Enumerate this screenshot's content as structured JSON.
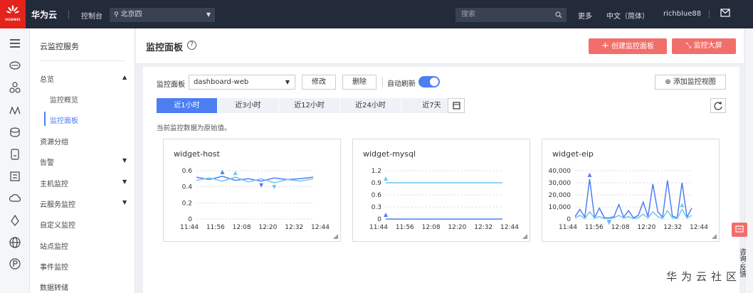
{
  "topbar": {
    "logo_text": "HUAWEI",
    "brand": "华为云",
    "console": "控制台",
    "region": "北京四",
    "search_placeholder": "搜索",
    "more": "更多",
    "language": "中文（简体）",
    "user": "richblue88"
  },
  "sidebar": {
    "title": "云监控服务",
    "items": [
      {
        "label": "总览",
        "caret": "▲"
      },
      {
        "label": "监控概览"
      },
      {
        "label": "监控面板"
      },
      {
        "label": "资源分组"
      },
      {
        "label": "告警",
        "caret": "▼"
      },
      {
        "label": "主机监控",
        "caret": "▼"
      },
      {
        "label": "云服务监控",
        "caret": "▼"
      },
      {
        "label": "自定义监控"
      },
      {
        "label": "站点监控"
      },
      {
        "label": "事件监控"
      },
      {
        "label": "数据转储"
      }
    ]
  },
  "header": {
    "title": "监控面板",
    "help": "?",
    "create_btn": "创建监控面板",
    "screen_btn": "监控大屏"
  },
  "toolbar": {
    "panel_label": "监控面板",
    "panel_value": "dashboard-web",
    "edit": "修改",
    "delete": "删除",
    "auto_refresh": "自动刷新",
    "add_view": "添加监控视图"
  },
  "tabs": [
    "近1小时",
    "近3小时",
    "近12小时",
    "近24小时",
    "近7天"
  ],
  "note": "当前监控数据为原始值。",
  "chart_data": [
    {
      "type": "line",
      "title": "widget-host",
      "x": [
        "11:44",
        "11:56",
        "12:08",
        "12:20",
        "12:32",
        "12:44"
      ],
      "yticks": [
        "0.6",
        "0.4",
        "0.2",
        "0"
      ],
      "ylim": [
        0,
        0.6
      ],
      "series": [
        {
          "color": "#4d7ff3",
          "values": [
            0.52,
            0.49,
            0.53,
            0.48,
            0.5,
            0.47,
            0.51,
            0.49,
            0.5,
            0.52
          ]
        },
        {
          "color": "#6fc6f0",
          "values": [
            0.48,
            0.51,
            0.47,
            0.52,
            0.46,
            0.5,
            0.45,
            0.49,
            0.47,
            0.5
          ]
        }
      ]
    },
    {
      "type": "line",
      "title": "widget-mysql",
      "x": [
        "11:44",
        "11:56",
        "12:08",
        "12:20",
        "12:32",
        "12:44"
      ],
      "yticks": [
        "1.2",
        "0.9",
        "0.6",
        "0.3",
        "0"
      ],
      "ylim": [
        0,
        1.2
      ],
      "series": [
        {
          "color": "#6fc6f0",
          "values": [
            0.9,
            0.9,
            0.9,
            0.9,
            0.9,
            0.9
          ]
        },
        {
          "color": "#4d7ff3",
          "values": [
            0.0,
            0.0,
            0.0,
            0.0,
            0.0,
            0.0
          ]
        }
      ]
    },
    {
      "type": "line",
      "title": "widget-eip",
      "x": [
        "11:44",
        "11:56",
        "12:08",
        "12:20",
        "12:32",
        "12:44"
      ],
      "yticks": [
        "40,000",
        "30,000",
        "20,000",
        "10,000",
        "0"
      ],
      "ylim": [
        0,
        40000
      ],
      "series": [
        {
          "color": "#4d7ff3",
          "values": [
            2000,
            8000,
            1500,
            33000,
            1000,
            9000,
            1200,
            800,
            2000,
            12000,
            1500,
            7000,
            1000,
            3000,
            14000,
            2000,
            29000,
            6000,
            1500,
            32000,
            2500,
            1000,
            30000,
            1500,
            9000
          ]
        },
        {
          "color": "#6fc6f0",
          "values": [
            1000,
            3000,
            500,
            6000,
            800,
            2000,
            500,
            300,
            1000,
            3000,
            800,
            2000,
            500,
            1000,
            4000,
            800,
            6000,
            2000,
            500,
            7000,
            1000,
            500,
            8000,
            800,
            3000
          ]
        }
      ]
    }
  ],
  "watermark": "华为云社区",
  "consult": "咨询·反馈"
}
